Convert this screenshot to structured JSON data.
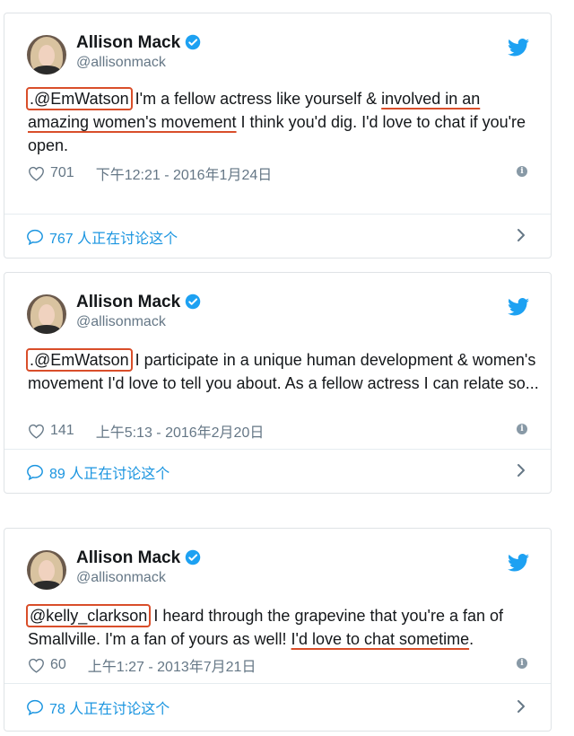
{
  "brand_color": "#1da1f2",
  "highlight_color": "#d94e2a",
  "tweets": [
    {
      "name": "Allison Mack",
      "handle": "@allisonmack",
      "mention": ".@EmWatson",
      "text_a": " I'm a fellow actress like yourself & ",
      "text_underline": "involved in an amazing women's movement",
      "text_b": " I think you'd dig. I'd love to chat if you're open.",
      "likes": "701",
      "timestamp": "下午12:21 - 2016年1月24日",
      "comments": "767 人正在讨论这个"
    },
    {
      "name": "Allison Mack",
      "handle": "@allisonmack",
      "mention": ".@EmWatson",
      "text_a": " I participate in a unique human development & women's movement I'd love to tell you about. As a fellow actress I can relate so...",
      "text_underline": "",
      "text_b": "",
      "likes": "141",
      "timestamp": "上午5:13 - 2016年2月20日",
      "comments": "89 人正在讨论这个"
    },
    {
      "name": "Allison Mack",
      "handle": "@allisonmack",
      "mention": "@kelly_clarkson",
      "text_a": " I heard through the grapevine that you're a fan of Smallville. I'm a fan of yours as well! ",
      "text_underline": "I'd love to chat sometime",
      "text_b": ".",
      "likes": "60",
      "timestamp": "上午1:27 - 2013年7月21日",
      "comments": "78 人正在讨论这个"
    }
  ]
}
